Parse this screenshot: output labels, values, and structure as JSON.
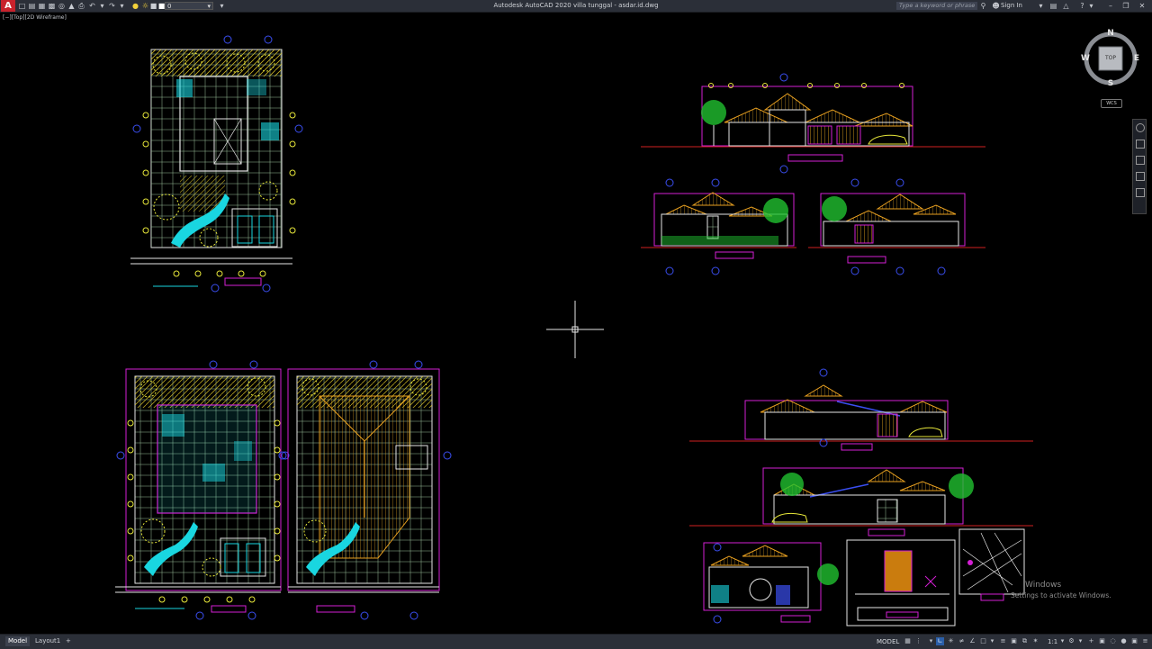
{
  "titlebar": {
    "app_logo": "A",
    "layer_value": "0",
    "app_title": "Autodesk AutoCAD 2020   villa tunggal - asdar.id.dwg",
    "search_placeholder": "Type a keyword or phrase",
    "sign_in": "Sign In"
  },
  "viewport": {
    "label": "[−][Top][2D Wireframe]"
  },
  "viewcube": {
    "north": "N",
    "south": "S",
    "east": "E",
    "west": "W",
    "face": "TOP",
    "wcs": "WCS"
  },
  "drawing": {
    "colors": {
      "yellow": "#e8e83a",
      "cyan": "#19d6e0",
      "magenta": "#d51fd5",
      "white": "#e6e6e6",
      "green": "#20c030",
      "red": "#d02020",
      "blue": "#3a4ef0",
      "orange": "#e08a10"
    }
  },
  "watermark": {
    "line1": "Windows",
    "line2": "Settings to activate Windows."
  },
  "statusbar": {
    "tabs": [
      "Model",
      "Layout1"
    ],
    "add_tab": "+",
    "model_button": "MODEL",
    "scale": "1:1"
  }
}
